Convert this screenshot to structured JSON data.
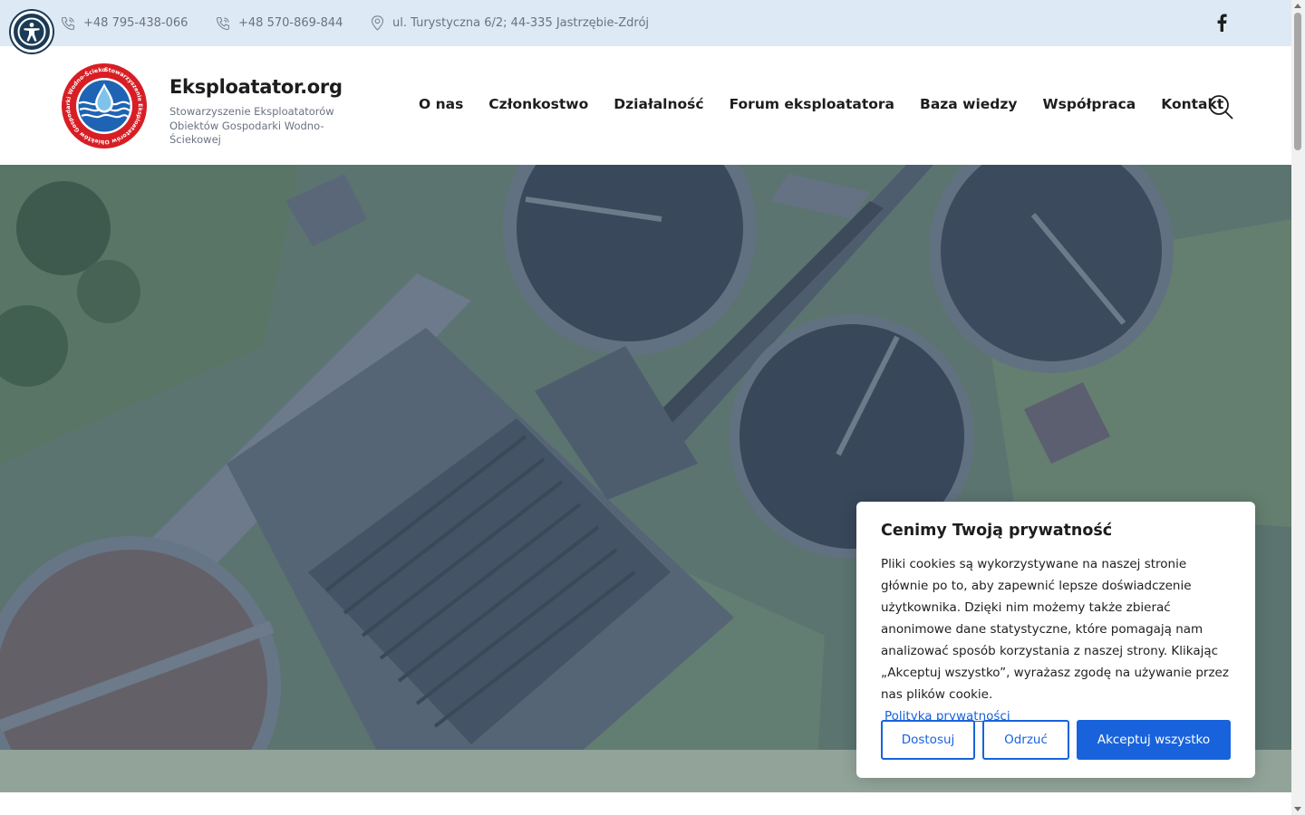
{
  "topbar": {
    "phone1": "+48 795-438-066",
    "phone2": "+48 570-869-844",
    "address": "ul. Turystyczna 6/2; 44-335 Jastrzębie-Zdrój",
    "social_icon": "facebook-icon"
  },
  "header": {
    "site_title": "Eksploatator.org",
    "site_subtitle": "Stowarzyszenie Eksploatatorów Obiektów Gospodarki Wodno-Ściekowej",
    "logo_text": "Stowarzyszenie Eksploatatorów Obiektów Gospodarki Wodno-Ściekowej",
    "nav": [
      "O nas",
      "Członkostwo",
      "Działalność",
      "Forum eksploatatora",
      "Baza wiedzy",
      "Współpraca",
      "Kontakt"
    ]
  },
  "cookie": {
    "title": "Cenimy Twoją prywatność",
    "text": "Pliki cookies są wykorzystywane na naszej stronie głównie po to, aby zapewnić lepsze doświadczenie użytkownika. Dzięki nim możemy także zbierać anonimowe dane statystyczne, które pomagają nam analizować sposób korzystania z naszej strony. Klikając „Akceptuj wszystko”, wyrażasz zgodę na używanie przez nas plików cookie.",
    "policy_link": "Polityka prywatności",
    "btn_customize": "Dostosuj",
    "btn_reject": "Odrzuć",
    "btn_accept": "Akceptuj wszystko"
  },
  "colors": {
    "topbar_bg": "#dde9f4",
    "accent": "#1863dc",
    "accessibility_bg": "#1b3a55"
  }
}
